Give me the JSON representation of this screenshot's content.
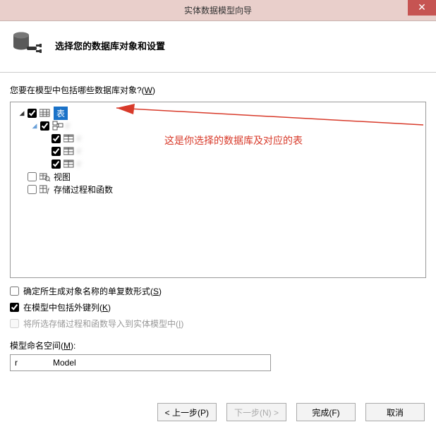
{
  "titlebar": {
    "title": "实体数据模型向导"
  },
  "header": {
    "text": "选择您的数据库对象和设置"
  },
  "question_prefix": "您要在模型中包括哪些数据库对象?(",
  "question_key": "W",
  "question_suffix": ")",
  "tree": {
    "root": {
      "label": "表",
      "checked": true
    },
    "db": {
      "label": "r",
      "checked": true
    },
    "tbl1": {
      "label": "r",
      "checked": true
    },
    "tbl2": {
      "label": "r",
      "checked": true
    },
    "tbl3": {
      "label": "r",
      "checked": true
    },
    "views": {
      "label": "视图",
      "checked": false
    },
    "sprocs": {
      "label": "存储过程和函数",
      "checked": false
    }
  },
  "annotation": "这是你选择的数据库及对应的表",
  "options": {
    "plural": {
      "label_prefix": "确定所生成对象名称的单复数形式(",
      "key": "S",
      "label_suffix": ")",
      "checked": false
    },
    "fk": {
      "label_prefix": "在模型中包括外键列(",
      "key": "K",
      "label_suffix": ")",
      "checked": true
    },
    "import": {
      "label_prefix": "将所选存储过程和函数导入到实体模型中(",
      "key": "I",
      "label_suffix": ")",
      "checked": false,
      "disabled": true
    }
  },
  "namespace": {
    "label_prefix": "模型命名空间(",
    "key": "M",
    "label_suffix": "):",
    "value": "r               Model"
  },
  "buttons": {
    "prev": "< 上一步(P)",
    "next": "下一步(N) >",
    "finish": "完成(F)",
    "cancel": "取消"
  }
}
